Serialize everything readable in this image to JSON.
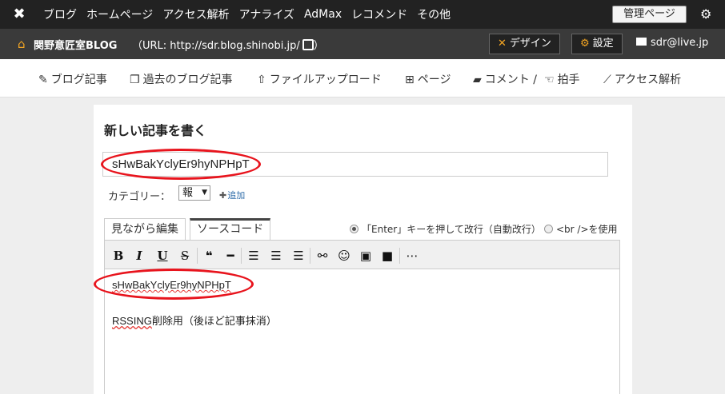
{
  "topbar": {
    "nav": [
      "ブログ",
      "ホームページ",
      "アクセス解析",
      "アナライズ",
      "AdMax",
      "レコメンド",
      "その他"
    ],
    "admin_button": "管理ページ"
  },
  "blogbar": {
    "blog_name": "関野意匠室BLOG",
    "blog_url": "（URL: http://sdr.blog.shinobi.jp/",
    "blog_url_close": "）",
    "design_button": "デザイン",
    "settings_button": "設定",
    "user_email": "sdr@live.jp"
  },
  "subnav": {
    "blog_posts": "ブログ記事",
    "past_posts": "過去のブログ記事",
    "file_upload": "ファイルアップロード",
    "page": "ページ",
    "comment": "コメント /",
    "clap": "拍手",
    "access": "アクセス解析"
  },
  "editor": {
    "heading": "新しい記事を書く",
    "title_value": "sHwBakYclyEr9hyNPHpT",
    "category_label": "カテゴリー：",
    "category_value": "報",
    "category_add": "追加",
    "tab_wysiwyg": "見ながら編集",
    "tab_source": "ソースコード",
    "radio_enter": "「Enter」キーを押して改行（自動改行）",
    "radio_br": "<br />を使用",
    "radio_enter_selected": true,
    "content_line1": "sHwBakYclyEr9hyNPHpT",
    "content_line2_prefix": "RSSING",
    "content_line2_rest": "削除用（後ほど記事抹消）"
  },
  "toolbar": {
    "bold": "B",
    "italic": "I",
    "underline": "U",
    "strike": "S"
  },
  "colors": {
    "topbar_bg": "#222222",
    "blogbar_bg": "#3a3a3a",
    "accent_orange": "#f5a623",
    "highlight_red": "#e8141d",
    "link_blue": "#2b6aa8"
  }
}
